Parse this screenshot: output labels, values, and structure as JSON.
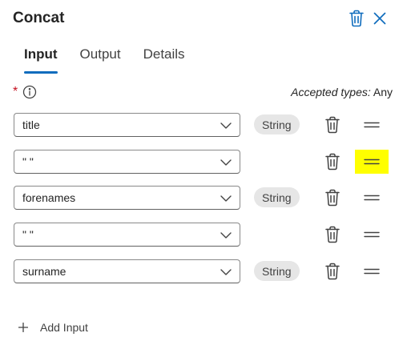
{
  "panel": {
    "title": "Concat"
  },
  "tabs": [
    {
      "label": "Input",
      "active": true
    },
    {
      "label": "Output",
      "active": false
    },
    {
      "label": "Details",
      "active": false
    }
  ],
  "required_marker": "*",
  "accepted": {
    "label": "Accepted types:",
    "value": "Any"
  },
  "inputs": [
    {
      "value": "title",
      "type_badge": "String",
      "handle_highlighted": false
    },
    {
      "value": "\" \"",
      "type_badge": "",
      "handle_highlighted": true
    },
    {
      "value": "forenames",
      "type_badge": "String",
      "handle_highlighted": false
    },
    {
      "value": "\" \"",
      "type_badge": "",
      "handle_highlighted": false
    },
    {
      "value": "surname",
      "type_badge": "String",
      "handle_highlighted": false
    }
  ],
  "add_input_label": "Add Input",
  "colors": {
    "accent": "#0f6cbd",
    "required": "#c50f1f",
    "highlight": "#ffff00",
    "badge_bg": "#e6e6e6"
  },
  "icons": [
    "trash-icon",
    "close-icon",
    "info-icon",
    "chevron-down-icon",
    "drag-handle-icon",
    "plus-icon"
  ]
}
